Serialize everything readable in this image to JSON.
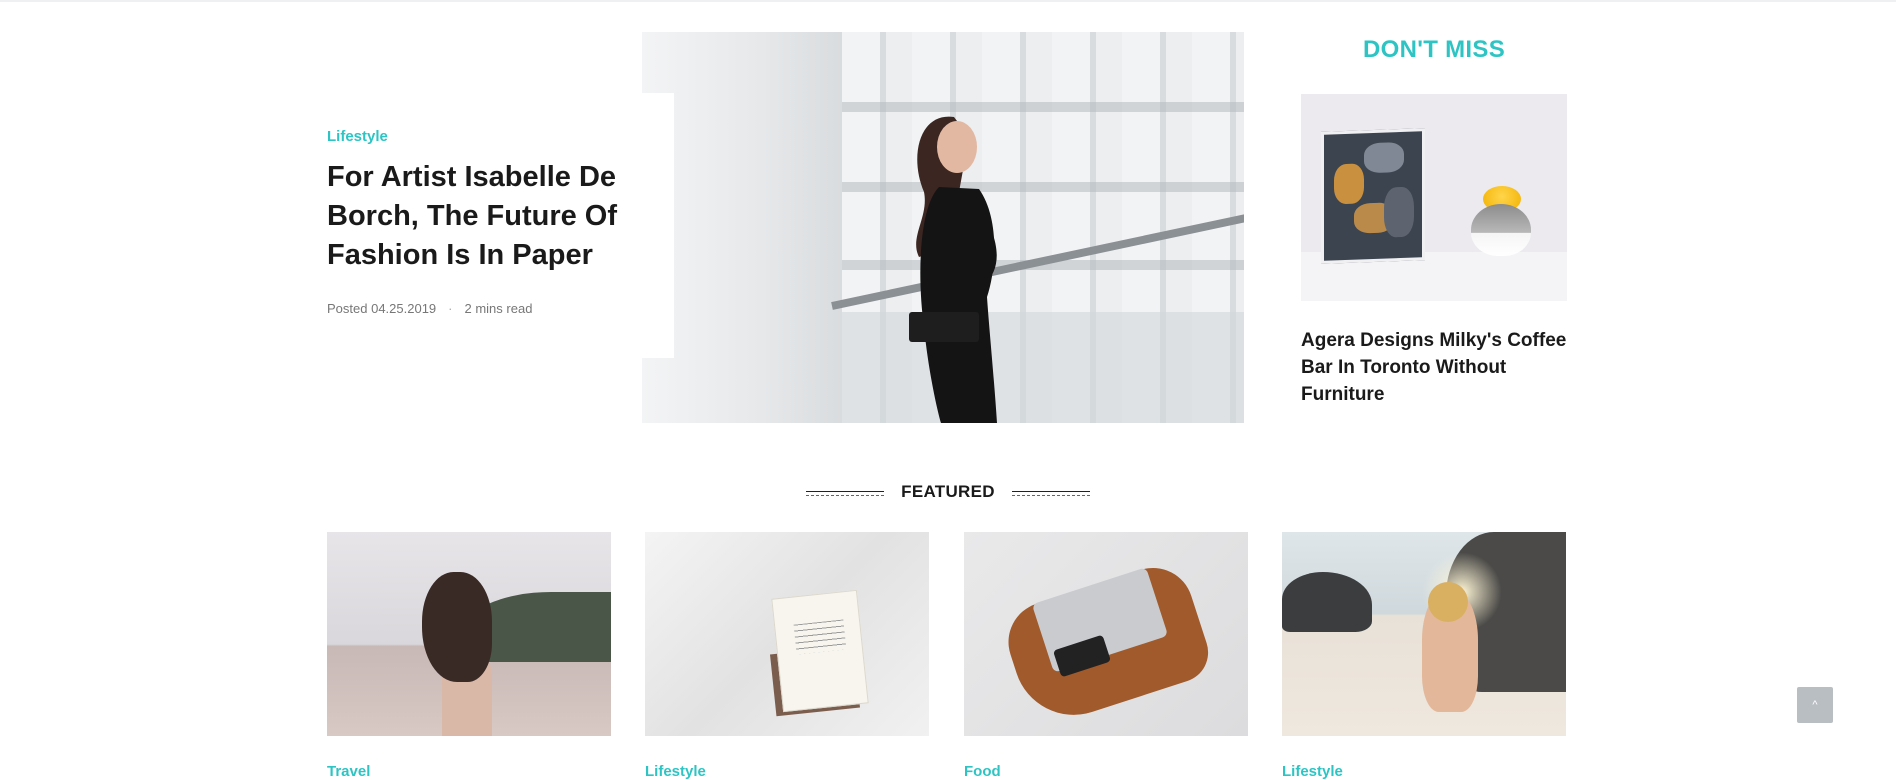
{
  "hero": {
    "category": "Lifestyle",
    "title": "For Artist Isabelle De Borch, The Future Of Fashion Is In Paper",
    "posted": "Posted 04.25.2019",
    "separator": "·",
    "read_time": "2 mins read"
  },
  "dont_miss": {
    "heading": "DON'T MISS",
    "headline": "Agera Designs Milky's Coffee Bar In Toronto Without Furniture"
  },
  "featured": {
    "heading": "FEATURED",
    "cards": [
      {
        "category": "Travel"
      },
      {
        "category": "Lifestyle"
      },
      {
        "category": "Food"
      },
      {
        "category": "Lifestyle"
      }
    ]
  },
  "scroll_top": {
    "icon": "chevron-up-icon",
    "glyph": "^"
  },
  "colors": {
    "accent": "#2ec4c4",
    "text": "#1a1a1a",
    "muted": "#777777"
  }
}
